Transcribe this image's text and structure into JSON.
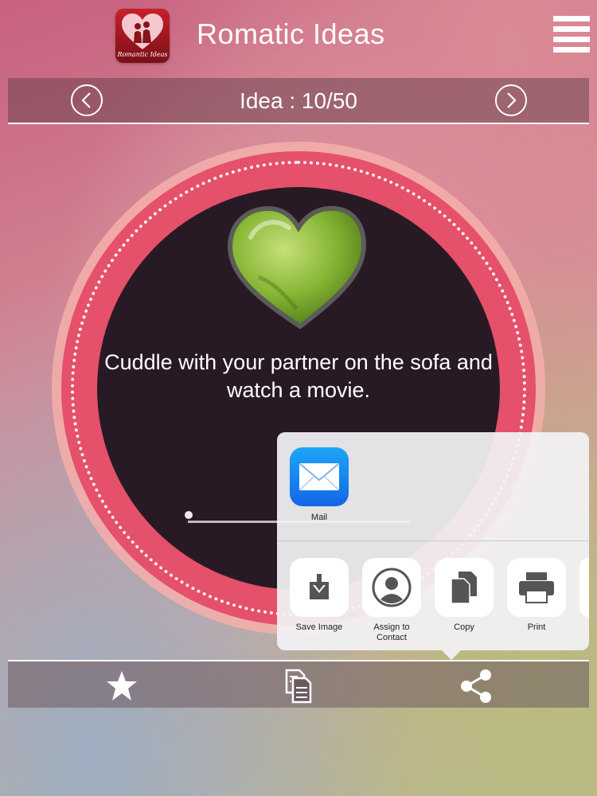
{
  "header": {
    "title": "Romatic Ideas",
    "logo_text": "Romantic Ideas",
    "logo_icon": "couple-heart-icon",
    "menu_icon": "hamburger-menu-icon"
  },
  "navigation": {
    "counter": "Idea : 10/50",
    "prev_icon": "chevron-left-icon",
    "next_icon": "chevron-right-icon",
    "current": 10,
    "total": 50
  },
  "idea": {
    "text": "Cuddle with your partner on the sofa and watch a movie.",
    "heart_color": "#7fb02e"
  },
  "share_sheet": {
    "apps": [
      {
        "label": "Mail",
        "icon": "mail-icon"
      }
    ],
    "actions": [
      {
        "label": "Save Image",
        "icon": "download-icon"
      },
      {
        "label": "Assign to Contact",
        "icon": "contact-icon"
      },
      {
        "label": "Copy",
        "icon": "copy-icon"
      },
      {
        "label": "Print",
        "icon": "printer-icon"
      }
    ]
  },
  "toolbar": {
    "items": [
      {
        "name": "favorite",
        "icon": "star-icon"
      },
      {
        "name": "copy",
        "icon": "document-copy-icon"
      },
      {
        "name": "share",
        "icon": "share-icon"
      }
    ]
  },
  "colors": {
    "ring": "#e5506a",
    "inner": "#281a25",
    "mail_blue": "#1a8cf2"
  }
}
